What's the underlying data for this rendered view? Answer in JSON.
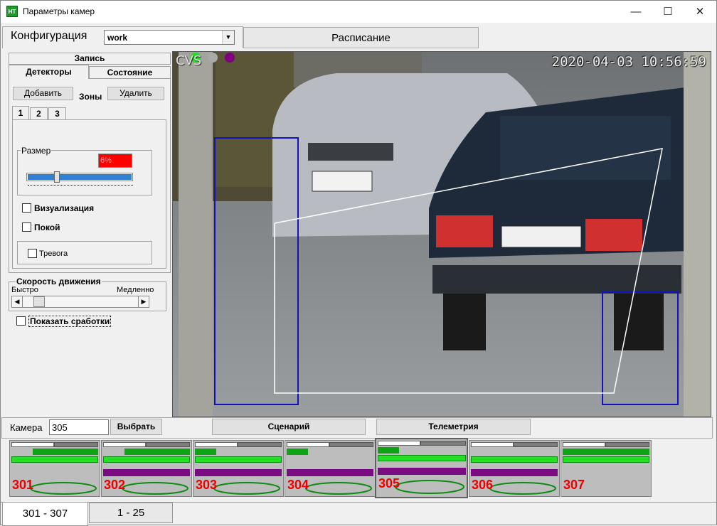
{
  "window": {
    "title": "Параметры камер",
    "app_icon_text": "HT",
    "minimize_icon": "minimize-icon",
    "maximize_icon": "maximize-icon",
    "close_icon": "close-icon"
  },
  "config": {
    "label": "Конфигурация",
    "select_value": "work",
    "tabs": {
      "config": "",
      "schedule": "Расписание"
    }
  },
  "left": {
    "tab_record": "Запись",
    "tab_detectors": "Детекторы",
    "tab_state": "Состояние",
    "add_button": "Добавить",
    "zones_label": "Зоны",
    "delete_button": "Удалить",
    "zone_tabs": [
      "1",
      "2",
      "3"
    ],
    "size_group": "Размер",
    "size_value": "6%",
    "size_level_percent": 6,
    "visualization": "Визуализация",
    "rest": "Покой",
    "alarm": "Тревога",
    "speed_group": "Скорость движения",
    "fast": "Быстро",
    "slow": "Медленно",
    "show_triggers": "Показать сработки"
  },
  "video": {
    "timestamp": "2020-04-03 10:56:59",
    "overlay_text": "CVS"
  },
  "camera_row": {
    "label": "Камера",
    "value": "305",
    "select_button": "Выбрать",
    "scenario_button": "Сценарий",
    "telemetry_button": "Телеметрия"
  },
  "cameras": [
    {
      "num": "301"
    },
    {
      "num": "302"
    },
    {
      "num": "303"
    },
    {
      "num": "304"
    },
    {
      "num": "305"
    },
    {
      "num": "306"
    },
    {
      "num": "307"
    }
  ],
  "bottom_tabs": [
    "301 - 307",
    "1 - 25"
  ],
  "colors": {
    "accent_green": "#0ea515",
    "alarm_red": "#e00000",
    "purple": "#7b0b82",
    "zone_blue": "#1010c0"
  }
}
